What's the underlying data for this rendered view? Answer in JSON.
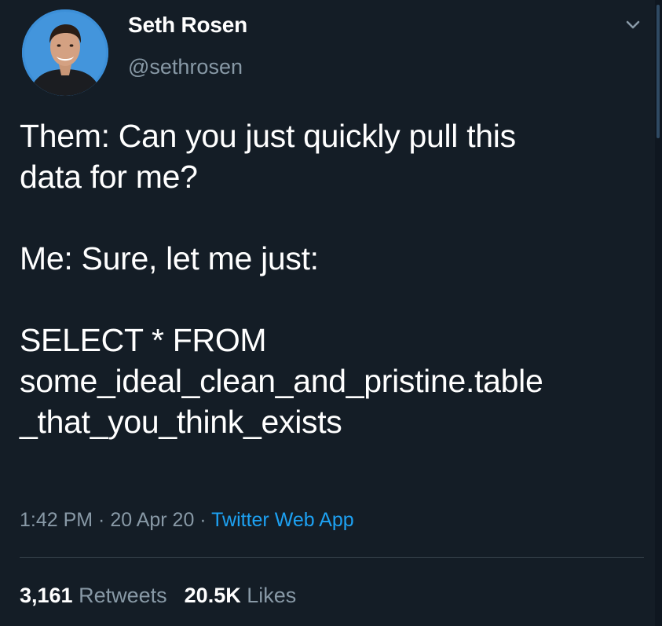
{
  "author": {
    "name": "Seth Rosen",
    "handle": "@sethrosen"
  },
  "tweet": {
    "paragraphs": [
      "Them: Can you just quickly pull this\ndata for me?",
      "Me: Sure, let me just:",
      "SELECT * FROM\nsome_ideal_clean_and_pristine.table\n_that_you_think_exists"
    ],
    "time": "1:42 PM",
    "separator": " · ",
    "date": "20 Apr 20",
    "source": "Twitter Web App"
  },
  "stats": {
    "retweets_count": "3,161",
    "retweets_label": "Retweets",
    "likes_count": "20.5K",
    "likes_label": "Likes"
  },
  "icons": {
    "menu": "chevron-down-icon"
  },
  "colors": {
    "background": "#141d26",
    "text": "#ffffff",
    "secondary": "#8899a6",
    "link": "#1da1f2",
    "divider": "#38444d",
    "avatar_bg": "#3c8fd8"
  }
}
